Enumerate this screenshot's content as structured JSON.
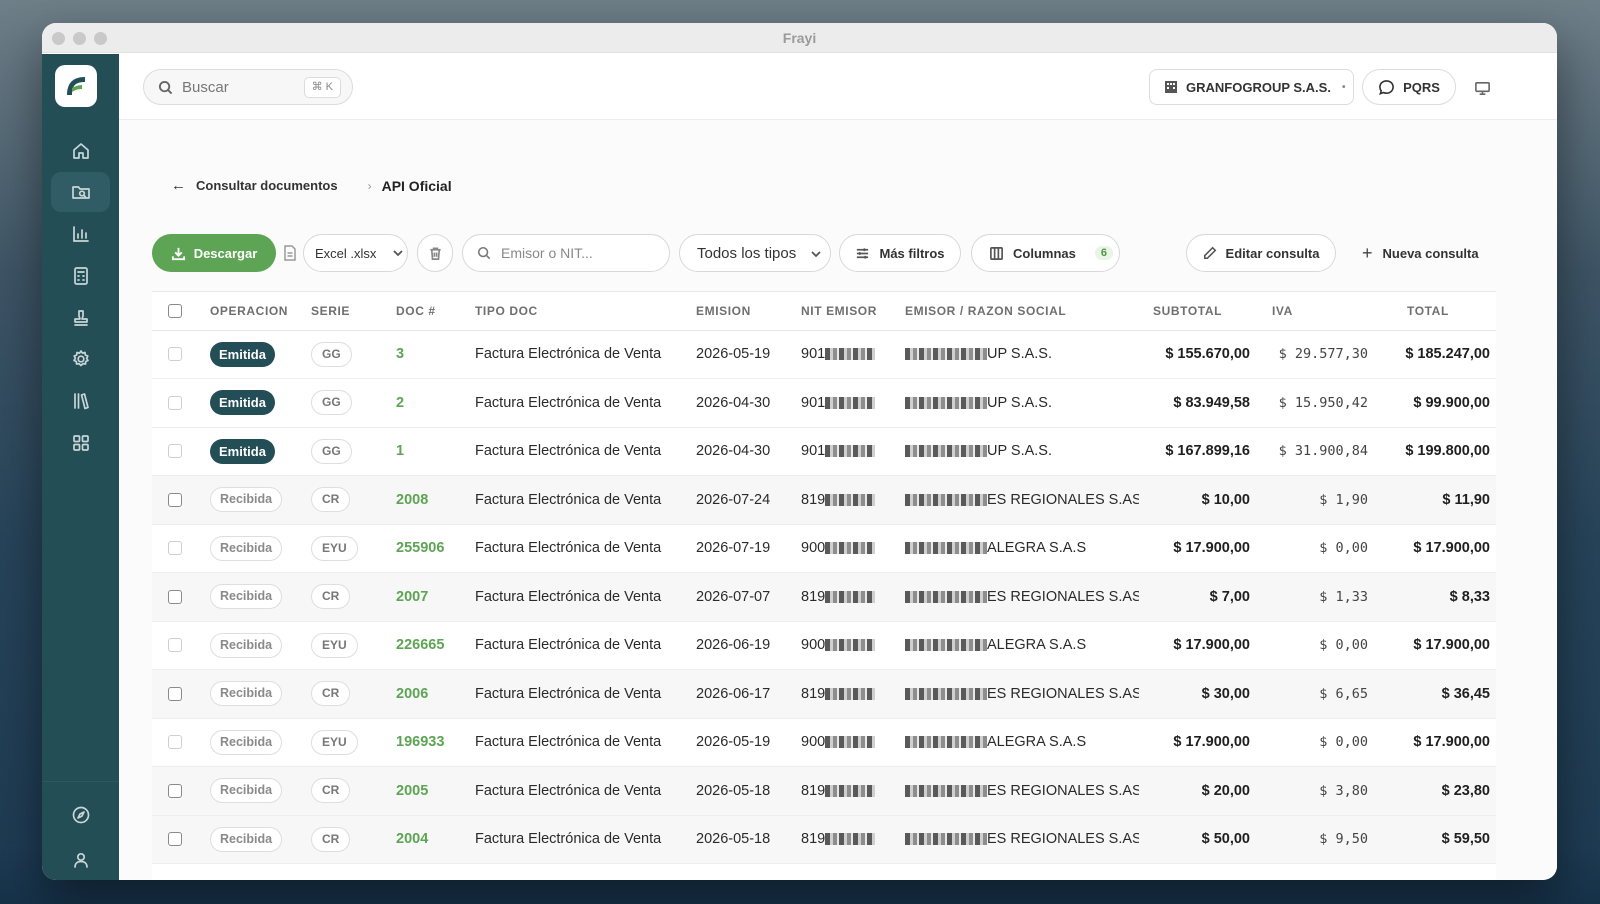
{
  "window": {
    "title": "Frayi"
  },
  "sidebar": {
    "items": [
      {
        "name": "home-icon",
        "active": false
      },
      {
        "name": "folder-search-icon",
        "active": true
      },
      {
        "name": "bar-chart-icon",
        "active": false
      },
      {
        "name": "calculator-icon",
        "active": false
      },
      {
        "name": "stamp-icon",
        "active": false
      },
      {
        "name": "settings-icon",
        "active": false
      },
      {
        "name": "library-icon",
        "active": false
      },
      {
        "name": "apps-grid-icon",
        "active": false
      }
    ],
    "bottom_items": [
      {
        "name": "compass-icon"
      },
      {
        "name": "user-icon"
      }
    ]
  },
  "topbar": {
    "search_placeholder": "Buscar",
    "search_shortcut": "⌘ K",
    "company": "GRANFOGROUP S.A.S.",
    "pqrs_label": "PQRS"
  },
  "breadcrumb": {
    "back_label": "Consultar documentos",
    "current": "API Oficial"
  },
  "toolbar": {
    "download_label": "Descargar",
    "format": "Excel .xlsx",
    "emisor_placeholder": "Emisor o NIT...",
    "type_filter": "Todos los tipos",
    "more_filters_label": "Más filtros",
    "columns_label": "Columnas",
    "columns_count": "6",
    "edit_query_label": "Editar consulta",
    "new_query_label": "Nueva consulta"
  },
  "table": {
    "columns": [
      "OPERACION",
      "SERIE",
      "DOC #",
      "TIPO DOC",
      "EMISION",
      "NIT EMISOR",
      "EMISOR / RAZON SOCIAL",
      "SUBTOTAL",
      "IVA",
      "TOTAL"
    ],
    "rows": [
      {
        "operacion": "Emitida",
        "serie": "GG",
        "doc": "3",
        "tipo": "Factura Electrónica de Venta",
        "emision": "2026-05-19",
        "nit": "901",
        "razon": "UP S.A.S.",
        "subtotal": "$ 155.670,00",
        "iva": "$ 29.577,30",
        "total": "$ 185.247,00"
      },
      {
        "operacion": "Emitida",
        "serie": "GG",
        "doc": "2",
        "tipo": "Factura Electrónica de Venta",
        "emision": "2026-04-30",
        "nit": "901",
        "razon": "UP S.A.S.",
        "subtotal": "$ 83.949,58",
        "iva": "$ 15.950,42",
        "total": "$ 99.900,00"
      },
      {
        "operacion": "Emitida",
        "serie": "GG",
        "doc": "1",
        "tipo": "Factura Electrónica de Venta",
        "emision": "2026-04-30",
        "nit": "901",
        "razon": "UP S.A.S.",
        "subtotal": "$ 167.899,16",
        "iva": "$ 31.900,84",
        "total": "$ 199.800,00"
      },
      {
        "operacion": "Recibida",
        "serie": "CR",
        "doc": "2008",
        "tipo": "Factura Electrónica de Venta",
        "emision": "2026-07-24",
        "nit": "819",
        "razon": "ES REGIONALES S.AS",
        "subtotal": "$ 10,00",
        "iva": "$ 1,90",
        "total": "$ 11,90"
      },
      {
        "operacion": "Recibida",
        "serie": "EYU",
        "doc": "255906",
        "tipo": "Factura Electrónica de Venta",
        "emision": "2026-07-19",
        "nit": "900",
        "razon": "ALEGRA S.A.S",
        "subtotal": "$ 17.900,00",
        "iva": "$ 0,00",
        "total": "$ 17.900,00"
      },
      {
        "operacion": "Recibida",
        "serie": "CR",
        "doc": "2007",
        "tipo": "Factura Electrónica de Venta",
        "emision": "2026-07-07",
        "nit": "819",
        "razon": "ES REGIONALES S.AS",
        "subtotal": "$ 7,00",
        "iva": "$ 1,33",
        "total": "$ 8,33"
      },
      {
        "operacion": "Recibida",
        "serie": "EYU",
        "doc": "226665",
        "tipo": "Factura Electrónica de Venta",
        "emision": "2026-06-19",
        "nit": "900",
        "razon": "ALEGRA S.A.S",
        "subtotal": "$ 17.900,00",
        "iva": "$ 0,00",
        "total": "$ 17.900,00"
      },
      {
        "operacion": "Recibida",
        "serie": "CR",
        "doc": "2006",
        "tipo": "Factura Electrónica de Venta",
        "emision": "2026-06-17",
        "nit": "819",
        "razon": "ES REGIONALES S.AS",
        "subtotal": "$ 30,00",
        "iva": "$ 6,65",
        "total": "$ 36,45"
      },
      {
        "operacion": "Recibida",
        "serie": "EYU",
        "doc": "196933",
        "tipo": "Factura Electrónica de Venta",
        "emision": "2026-05-19",
        "nit": "900",
        "razon": "ALEGRA S.A.S",
        "subtotal": "$ 17.900,00",
        "iva": "$ 0,00",
        "total": "$ 17.900,00"
      },
      {
        "operacion": "Recibida",
        "serie": "CR",
        "doc": "2005",
        "tipo": "Factura Electrónica de Venta",
        "emision": "2026-05-18",
        "nit": "819",
        "razon": "ES REGIONALES S.AS",
        "subtotal": "$ 20,00",
        "iva": "$ 3,80",
        "total": "$ 23,80"
      },
      {
        "operacion": "Recibida",
        "serie": "CR",
        "doc": "2004",
        "tipo": "Factura Electrónica de Venta",
        "emision": "2026-05-18",
        "nit": "819",
        "razon": "ES REGIONALES S.AS",
        "subtotal": "$ 50,00",
        "iva": "$ 9,50",
        "total": "$ 59,50"
      }
    ]
  }
}
